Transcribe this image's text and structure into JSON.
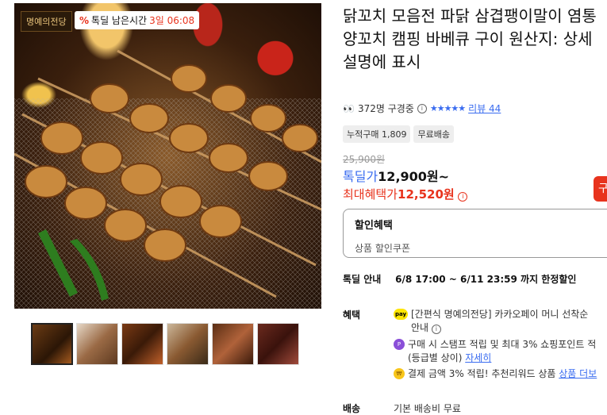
{
  "product": {
    "title": "닭꼬치 모음전 파닭 삼겹팽이말이 염통 양꼬치 캠핑 바베큐 구이 원산지: 상세설명에 표시",
    "viewers": "372명 구경중",
    "rating_stars": "★★★★★",
    "review_label": "리뷰 44",
    "tags": [
      "누적구매 1,809",
      "무료배송"
    ]
  },
  "image": {
    "brand_badge": "명예의전당",
    "deal_badge_icon": "%",
    "deal_badge_label": "톡딜 남은시간",
    "deal_badge_time": "3일 06:08",
    "thumbnail_count": 6
  },
  "price": {
    "original": "25,900원",
    "deal_label": "톡딜가",
    "deal_value": "12,900원~",
    "max_benefit_label": "최대혜택가",
    "max_benefit_value": "12,520원",
    "buy_button": "구"
  },
  "discount": {
    "header": "할인혜택",
    "sub": "상품 할인쿠폰"
  },
  "deal_info": {
    "label": "톡딜 안내",
    "value": "6/8 17:00 ~ 6/11 23:59 까지 한정할인"
  },
  "benefits": {
    "label": "혜택",
    "items": [
      {
        "icon": "kakaopay-icon",
        "badge": "pay",
        "text": "[간편식 명예의전당] 카카오페이 머니 선착순 ",
        "text2": "안내"
      },
      {
        "icon": "point-icon",
        "badge": "P",
        "text": "구매 시 스탬프 적립 및 최대 3% 쇼핑포인트 적",
        "text2": "(등급별 상이)",
        "link": "자세히"
      },
      {
        "icon": "coin-icon",
        "badge": "₩",
        "text": "결제 금액 3% 적립! 추천리워드 상품 ",
        "link": "상품 더보"
      }
    ]
  },
  "shipping": {
    "label": "배송",
    "value": "기본 배송비 무료"
  }
}
